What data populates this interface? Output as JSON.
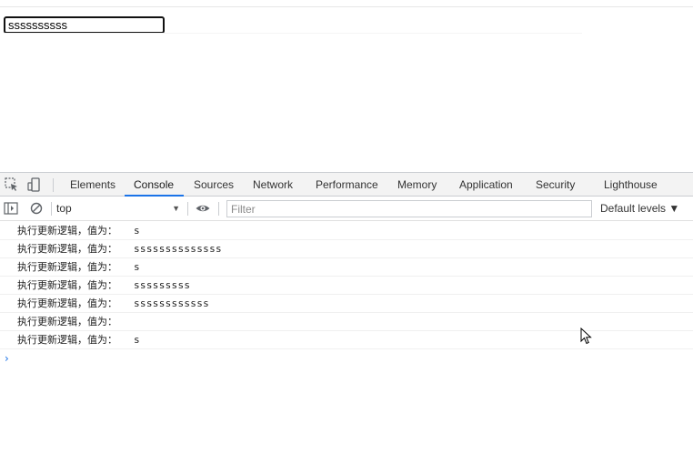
{
  "page": {
    "input_value": "ssssssssss"
  },
  "devtools": {
    "tabs": [
      {
        "label": "Elements"
      },
      {
        "label": "Console"
      },
      {
        "label": "Sources"
      },
      {
        "label": "Network"
      },
      {
        "label": "Performance"
      },
      {
        "label": "Memory"
      },
      {
        "label": "Application"
      },
      {
        "label": "Security"
      },
      {
        "label": "Lighthouse"
      }
    ],
    "active_tab": "Console",
    "toolbar": {
      "context": "top",
      "filter_placeholder": "Filter",
      "levels_label": "Default levels ▼"
    },
    "accent_color": "#1a73e8",
    "icons": [
      "inspect-element-icon",
      "device-toolbar-icon",
      "sidebar-toggle-icon",
      "clear-console-icon",
      "live-expression-eye-icon",
      "console-prompt-chevron-icon"
    ]
  },
  "console": {
    "logs": [
      {
        "label": "执行更新逻辑，值为：",
        "value": "s"
      },
      {
        "label": "执行更新逻辑，值为：",
        "value": "ssssssssssssss"
      },
      {
        "label": "执行更新逻辑，值为：",
        "value": "s"
      },
      {
        "label": "执行更新逻辑，值为：",
        "value": "sssssssss"
      },
      {
        "label": "执行更新逻辑，值为：",
        "value": "ssssssssssss"
      },
      {
        "label": "执行更新逻辑，值为：",
        "value": ""
      },
      {
        "label": "执行更新逻辑，值为：",
        "value": "s"
      }
    ],
    "prompt_glyph": "›"
  }
}
